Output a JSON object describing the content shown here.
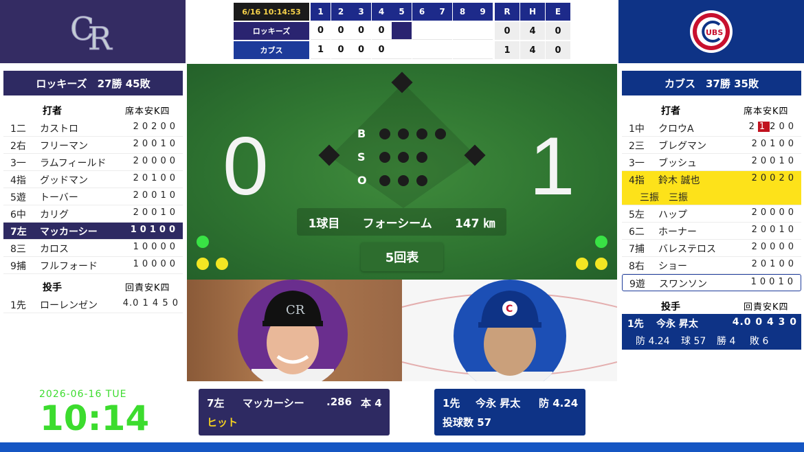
{
  "linescore": {
    "time": "6/16 10:14:53",
    "innings": [
      "1",
      "2",
      "3",
      "4",
      "5",
      "6",
      "7",
      "8",
      "9"
    ],
    "rhe": [
      "R",
      "H",
      "E"
    ],
    "away": {
      "name": "ロッキーズ",
      "scores": [
        "0",
        "0",
        "0",
        "0",
        "",
        "",
        "",
        "",
        ""
      ],
      "rhe": [
        "0",
        "4",
        "0"
      ]
    },
    "home": {
      "name": "カブス",
      "scores": [
        "1",
        "0",
        "0",
        "0",
        "",
        "",
        "",
        "",
        ""
      ],
      "rhe": [
        "1",
        "4",
        "0"
      ]
    }
  },
  "away": {
    "title": "ロッキーズ　27勝 45敗",
    "batter_header": "打者",
    "stat_header": "席本安K四",
    "batters": [
      {
        "pos": "1二",
        "name": "カストロ",
        "stats": "20200"
      },
      {
        "pos": "2右",
        "name": "フリーマン",
        "stats": "20010"
      },
      {
        "pos": "3一",
        "name": "ラムフィールド",
        "stats": "20000"
      },
      {
        "pos": "4指",
        "name": "グッドマン",
        "stats": "20100"
      },
      {
        "pos": "5遊",
        "name": "トーバー",
        "stats": "20010"
      },
      {
        "pos": "6中",
        "name": "カリグ",
        "stats": "20010"
      },
      {
        "pos": "7左",
        "name": "マッカーシー",
        "stats": "10100"
      },
      {
        "pos": "8三",
        "name": "カロス",
        "stats": "10000"
      },
      {
        "pos": "9捕",
        "name": "フルフォード",
        "stats": "10000"
      }
    ],
    "pitcher_header": "投手",
    "pitcher_stat_header": "回責安K四",
    "pitchers": [
      {
        "pos": "1先",
        "name": "ローレンゼン",
        "stats": "4.0 1 4 5 0"
      }
    ]
  },
  "home": {
    "title": "カブス　37勝 35敗",
    "batter_header": "打者",
    "stat_header": "席本安K四",
    "batters": [
      {
        "pos": "1中",
        "name": "クロウA",
        "stat_a": "2",
        "stat_mark": "1",
        "stat_b": "200"
      },
      {
        "pos": "2三",
        "name": "ブレグマン",
        "stats": "20100"
      },
      {
        "pos": "3一",
        "name": "ブッシュ",
        "stats": "20010"
      },
      {
        "pos": "4指",
        "name": "鈴木 誠也",
        "stats": "20020",
        "note": "三振　三振"
      },
      {
        "pos": "5左",
        "name": "ハップ",
        "stats": "20000"
      },
      {
        "pos": "6二",
        "name": "ホーナー",
        "stats": "20010"
      },
      {
        "pos": "7捕",
        "name": "バレステロス",
        "stats": "20000"
      },
      {
        "pos": "8右",
        "name": "ショー",
        "stats": "20100"
      },
      {
        "pos": "9遊",
        "name": "スワンソン",
        "stats": "10010"
      }
    ],
    "pitcher_header": "投手",
    "pitcher_stat_header": "回責安K四",
    "pitcher": {
      "pos": "1先",
      "name": "今永 昇太",
      "stats": "4.0 0 4 3 0",
      "era": "防 4.24",
      "pitches": "球 57",
      "wins": "勝 4",
      "losses": "敗 6"
    }
  },
  "field": {
    "away_score": "0",
    "home_score": "1",
    "b_label": "B",
    "s_label": "S",
    "o_label": "O",
    "pitch_count_label": "1球目",
    "pitch_type": "フォーシーム",
    "pitch_speed": "147 ㎞",
    "inning": "5回表"
  },
  "batter_info": {
    "line1_pos": "7左",
    "line1_name": "マッカーシー",
    "avg": ".286",
    "hr": "本 4",
    "result": "ヒット"
  },
  "pitcher_info": {
    "pos": "1先",
    "name": "今永 昇太",
    "era": "防 4.24",
    "pitches": "投球数 57"
  },
  "clock": {
    "date": "2026-06-16 TUE",
    "time": "10:14"
  },
  "colors": {
    "rockies": "#342c63",
    "cubs": "#0e3386",
    "highlight": "#fde21a",
    "clock": "#3cdc2e",
    "field": "#2f7531"
  },
  "icons": {
    "away_logo": "rockies-cr-logo",
    "home_logo": "cubs-logo"
  }
}
